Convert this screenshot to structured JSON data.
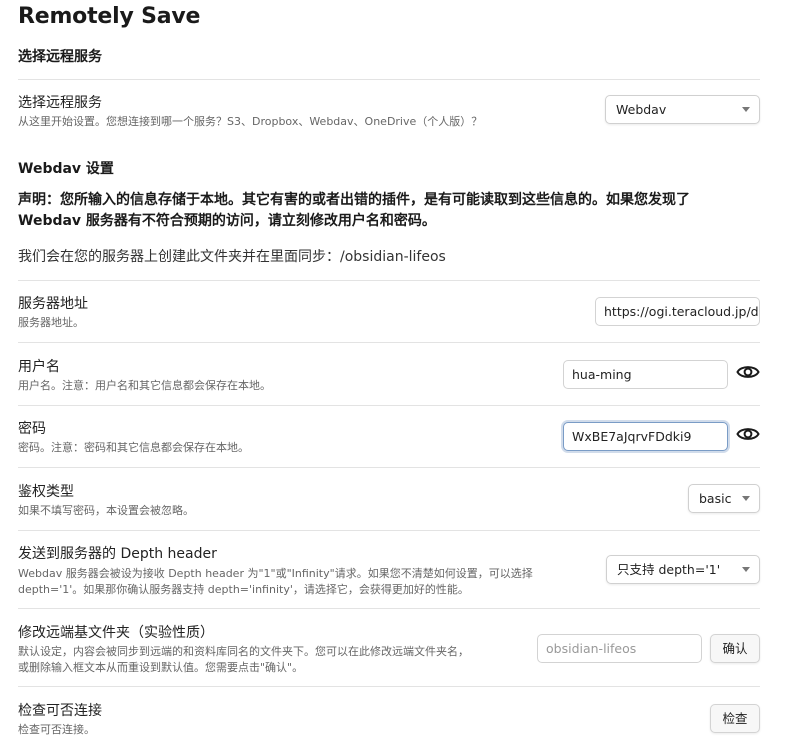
{
  "page_title": "Remotely Save",
  "section_remote": "选择远程服务",
  "remote_service": {
    "name": "选择远程服务",
    "desc": "从这里开始设置。您想连接到哪一个服务？S3、Dropbox、Webdav、OneDrive（个人版）？",
    "selected": "Webdav"
  },
  "section_webdav": "Webdav 设置",
  "notice": {
    "line1": "声明：您所输入的信息存储于本地。其它有害的或者出错的插件，是有可能读取到这些信息的。如果您发现了",
    "line2": "Webdav 服务器有不符合预期的访问，请立刻修改用户名和密码。"
  },
  "sync_folder_line": "我们会在您的服务器上创建此文件夹并在里面同步：/obsidian-lifeos",
  "server": {
    "name": "服务器地址",
    "desc": "服务器地址。",
    "value": "https://ogi.teracloud.jp/dav/"
  },
  "username": {
    "name": "用户名",
    "desc": "用户名。注意：用户名和其它信息都会保存在本地。",
    "value": "hua-ming"
  },
  "password": {
    "name": "密码",
    "desc": "密码。注意：密码和其它信息都会保存在本地。",
    "value": "WxBE7aJqrvFDdki9"
  },
  "auth": {
    "name": "鉴权类型",
    "desc": "如果不填写密码，本设置会被忽略。",
    "selected": "basic"
  },
  "depth": {
    "name": "发送到服务器的 Depth header",
    "desc_line1": "Webdav 服务器会被设为接收 Depth header 为\"1\"或\"Infinity\"请求。如果您不清楚如何设置，可以选择",
    "desc_line2": "depth='1'。如果那你确认服务器支持 depth='infinity'，请选择它，会获得更加好的性能。",
    "selected": "只支持 depth='1'"
  },
  "remote_base": {
    "name": "修改远端基文件夹（实验性质）",
    "desc_line1": "默认设定，内容会被同步到远端的和资料库同名的文件夹下。您可以在此修改远端文件夹名，",
    "desc_line2": "或删除输入框文本从而重设到默认值。您需要点击\"确认\"。",
    "placeholder": "obsidian-lifeos",
    "confirm_label": "确认"
  },
  "check": {
    "name": "检查可否连接",
    "desc": "检查可否连接。",
    "button_label": "检查"
  }
}
